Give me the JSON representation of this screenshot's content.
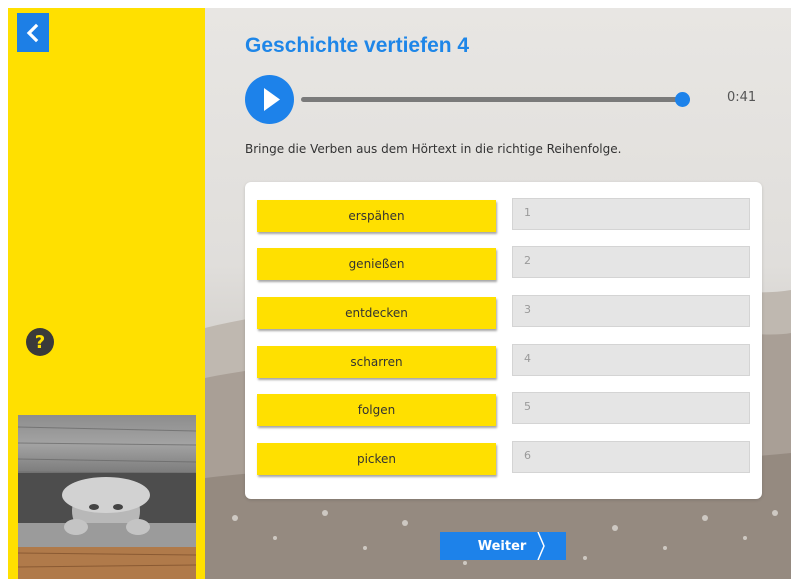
{
  "header": {
    "title": "Geschichte vertiefen 4"
  },
  "audio": {
    "time": "0:41",
    "progress": 0.98
  },
  "instruction": "Bringe die Verben aus dem Hörtext in die richtige Reihenfolge.",
  "verbs": [
    "erspähen",
    "genießen",
    "entdecken",
    "scharren",
    "folgen",
    "picken"
  ],
  "slots": [
    "1",
    "2",
    "3",
    "4",
    "5",
    "6"
  ],
  "footer": {
    "next_label": "Weiter"
  },
  "icons": {
    "back": "chevron-left-icon",
    "help": "question-icon",
    "play": "play-icon"
  },
  "colors": {
    "accent": "#1d82ea",
    "yellow": "#ffe000"
  }
}
